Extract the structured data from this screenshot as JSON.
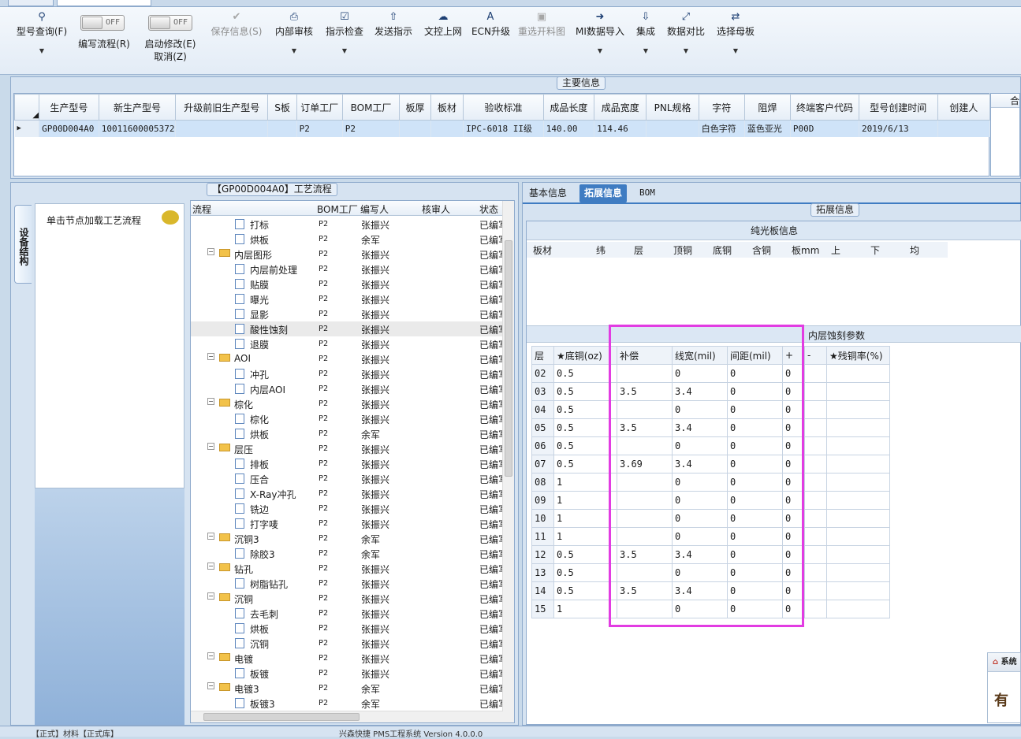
{
  "ribbon": {
    "query": {
      "label": "型号查询(F)"
    },
    "write_flow": {
      "state": "OFF",
      "label": "编写流程(R)"
    },
    "start_modify": {
      "state": "OFF",
      "label": "启动修改(E)",
      "sub": "取消(Z)"
    },
    "save_info": {
      "label": "保存信息(S)"
    },
    "internal_review": {
      "label": "内部审核"
    },
    "check_instruction": {
      "label": "指示检查"
    },
    "send_instruction": {
      "label": "发送指示"
    },
    "doc_upload": {
      "label": "文控上网"
    },
    "ecn_upgrade": {
      "label": "ECN升级"
    },
    "reselect_image": {
      "label": "重选开料图"
    },
    "mi_import": {
      "label": "MI数据导入"
    },
    "integrate": {
      "label": "集成"
    },
    "data_compare": {
      "label": "数据对比"
    },
    "select_master": {
      "label": "选择母板"
    }
  },
  "main_info": {
    "title": "主要信息",
    "columns": [
      "生产型号",
      "新生产型号",
      "升级前旧生产型号",
      "S板",
      "订单工厂",
      "BOM工厂",
      "板厚",
      "板材",
      "验收标准",
      "成品长度",
      "成品宽度",
      "PNL规格",
      "字符",
      "阻焊",
      "终端客户代码",
      "型号创建时间",
      "创建人"
    ],
    "row": [
      "GP00D004A0",
      "10011600005372",
      "",
      "",
      "P2",
      "P2",
      "",
      "",
      "IPC-6018 II级",
      "140.00",
      "114.46",
      "",
      "白色字符",
      "蓝色亚光",
      "P00D",
      "2019/6/13",
      ""
    ],
    "right_stub": "合"
  },
  "left": {
    "vertical_tab": "设备结构",
    "node_hint": "单击节点加载工艺流程",
    "flow_title": "【GP00D004A0】工艺流程",
    "flow_columns": [
      "流程",
      "BOM工厂",
      "编写人",
      "核审人",
      "状态"
    ],
    "flow_rows": [
      {
        "name": "打标",
        "type": "doc",
        "level": 2,
        "factory": "P2",
        "writer": "张振兴",
        "status": "已编写"
      },
      {
        "name": "烘板",
        "type": "doc",
        "level": 2,
        "factory": "P2",
        "writer": "余军",
        "status": "已编写"
      },
      {
        "name": "内层图形",
        "type": "folder",
        "level": 1,
        "factory": "P2",
        "writer": "张振兴",
        "status": "已编写"
      },
      {
        "name": "内层前处理",
        "type": "doc",
        "level": 2,
        "factory": "P2",
        "writer": "张振兴",
        "status": "已编写"
      },
      {
        "name": "贴膜",
        "type": "doc",
        "level": 2,
        "factory": "P2",
        "writer": "张振兴",
        "status": "已编写"
      },
      {
        "name": "曝光",
        "type": "doc",
        "level": 2,
        "factory": "P2",
        "writer": "张振兴",
        "status": "已编写"
      },
      {
        "name": "显影",
        "type": "doc",
        "level": 2,
        "factory": "P2",
        "writer": "张振兴",
        "status": "已编写"
      },
      {
        "name": "酸性蚀刻",
        "type": "doc",
        "level": 2,
        "factory": "P2",
        "writer": "张振兴",
        "status": "已编写",
        "selected": true
      },
      {
        "name": "退膜",
        "type": "doc",
        "level": 2,
        "factory": "P2",
        "writer": "张振兴",
        "status": "已编写"
      },
      {
        "name": "AOI",
        "type": "folder",
        "level": 1,
        "factory": "P2",
        "writer": "张振兴",
        "status": "已编写"
      },
      {
        "name": "冲孔",
        "type": "doc",
        "level": 2,
        "factory": "P2",
        "writer": "张振兴",
        "status": "已编写"
      },
      {
        "name": "内层AOI",
        "type": "doc",
        "level": 2,
        "factory": "P2",
        "writer": "张振兴",
        "status": "已编写"
      },
      {
        "name": "棕化",
        "type": "folder",
        "level": 1,
        "factory": "P2",
        "writer": "张振兴",
        "status": "已编写"
      },
      {
        "name": "棕化",
        "type": "doc",
        "level": 2,
        "factory": "P2",
        "writer": "张振兴",
        "status": "已编写"
      },
      {
        "name": "烘板",
        "type": "doc",
        "level": 2,
        "factory": "P2",
        "writer": "余军",
        "status": "已编写"
      },
      {
        "name": "层压",
        "type": "folder",
        "level": 1,
        "factory": "P2",
        "writer": "张振兴",
        "status": "已编写"
      },
      {
        "name": "排板",
        "type": "doc",
        "level": 2,
        "factory": "P2",
        "writer": "张振兴",
        "status": "已编写"
      },
      {
        "name": "压合",
        "type": "doc",
        "level": 2,
        "factory": "P2",
        "writer": "张振兴",
        "status": "已编写"
      },
      {
        "name": "X-Ray冲孔",
        "type": "doc",
        "level": 2,
        "factory": "P2",
        "writer": "张振兴",
        "status": "已编写"
      },
      {
        "name": "铣边",
        "type": "doc",
        "level": 2,
        "factory": "P2",
        "writer": "张振兴",
        "status": "已编写"
      },
      {
        "name": "打字唛",
        "type": "doc",
        "level": 2,
        "factory": "P2",
        "writer": "张振兴",
        "status": "已编写"
      },
      {
        "name": "沉铜3",
        "type": "folder",
        "level": 1,
        "factory": "P2",
        "writer": "余军",
        "status": "已编写"
      },
      {
        "name": "除胶3",
        "type": "doc",
        "level": 2,
        "factory": "P2",
        "writer": "余军",
        "status": "已编写"
      },
      {
        "name": "钻孔",
        "type": "folder",
        "level": 1,
        "factory": "P2",
        "writer": "张振兴",
        "status": "已编写"
      },
      {
        "name": "树脂钻孔",
        "type": "doc",
        "level": 2,
        "factory": "P2",
        "writer": "张振兴",
        "status": "已编写"
      },
      {
        "name": "沉铜",
        "type": "folder",
        "level": 1,
        "factory": "P2",
        "writer": "张振兴",
        "status": "已编写"
      },
      {
        "name": "去毛刺",
        "type": "doc",
        "level": 2,
        "factory": "P2",
        "writer": "张振兴",
        "status": "已编写"
      },
      {
        "name": "烘板",
        "type": "doc",
        "level": 2,
        "factory": "P2",
        "writer": "张振兴",
        "status": "已编写"
      },
      {
        "name": "沉铜",
        "type": "doc",
        "level": 2,
        "factory": "P2",
        "writer": "张振兴",
        "status": "已编写"
      },
      {
        "name": "电镀",
        "type": "folder",
        "level": 1,
        "factory": "P2",
        "writer": "张振兴",
        "status": "已编写"
      },
      {
        "name": "板镀",
        "type": "doc",
        "level": 2,
        "factory": "P2",
        "writer": "张振兴",
        "status": "已编写"
      },
      {
        "name": "电镀3",
        "type": "folder",
        "level": 1,
        "factory": "P2",
        "writer": "余军",
        "status": "已编写"
      },
      {
        "name": "板镀3",
        "type": "doc",
        "level": 2,
        "factory": "P2",
        "writer": "余军",
        "status": "已编写"
      }
    ]
  },
  "right": {
    "tabs": [
      "基本信息",
      "拓展信息",
      "BOM"
    ],
    "active_tab": 1,
    "group_title": "拓展信息",
    "plain_title": "纯光板信息",
    "plain_columns": [
      "板材",
      "纬",
      "层",
      "顶铜",
      "底铜",
      "含铜",
      "板mm",
      "上",
      "下",
      "均"
    ],
    "inner_title": "内层蚀刻参数",
    "etch_columns": [
      "层",
      "★底铜(oz)",
      "补偿",
      "线宽(mil)",
      "间距(mil)",
      "+",
      "-",
      "★残铜率(%)"
    ],
    "etch_rows": [
      [
        "02",
        "0.5",
        "",
        "0",
        "0",
        "0",
        "",
        ""
      ],
      [
        "03",
        "0.5",
        "3.5",
        "3.4",
        "0",
        "0",
        "",
        ""
      ],
      [
        "04",
        "0.5",
        "",
        "0",
        "0",
        "0",
        "",
        ""
      ],
      [
        "05",
        "0.5",
        "3.5",
        "3.4",
        "0",
        "0",
        "",
        ""
      ],
      [
        "06",
        "0.5",
        "",
        "0",
        "0",
        "0",
        "",
        ""
      ],
      [
        "07",
        "0.5",
        "3.69",
        "3.4",
        "0",
        "0",
        "",
        ""
      ],
      [
        "08",
        "1",
        "",
        "0",
        "0",
        "0",
        "",
        ""
      ],
      [
        "09",
        "1",
        "",
        "0",
        "0",
        "0",
        "",
        ""
      ],
      [
        "10",
        "1",
        "",
        "0",
        "0",
        "0",
        "",
        ""
      ],
      [
        "11",
        "1",
        "",
        "0",
        "0",
        "0",
        "",
        ""
      ],
      [
        "12",
        "0.5",
        "3.5",
        "3.4",
        "0",
        "0",
        "",
        ""
      ],
      [
        "13",
        "0.5",
        "",
        "0",
        "0",
        "0",
        "",
        ""
      ],
      [
        "14",
        "0.5",
        "3.5",
        "3.4",
        "0",
        "0",
        "",
        ""
      ],
      [
        "15",
        "1",
        "",
        "0",
        "0",
        "0",
        "",
        ""
      ]
    ]
  },
  "popup": {
    "title": "系统",
    "text": "有"
  },
  "status": {
    "left": "【正式】材料【正式库】",
    "center": "兴森快捷 PMS工程系统 Version 4.0.0.0"
  },
  "colors": {
    "highlight": "#e23ce2",
    "selected_row": "#cfe3f8",
    "active_tab": "#3f7cc2"
  }
}
